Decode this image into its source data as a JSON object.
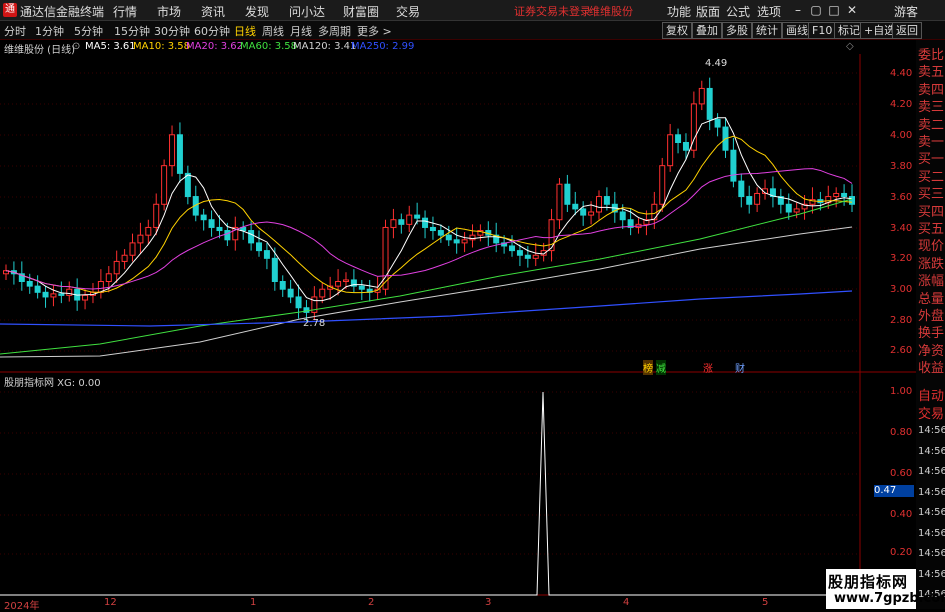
{
  "app": {
    "title": "通达信金融终端",
    "logo": "logo-icon"
  },
  "menu": [
    "行情",
    "市场",
    "资讯",
    "发现",
    "问小达",
    "财富圈",
    "交易"
  ],
  "notice": [
    "证券交易未登录",
    "维维股份"
  ],
  "menu_right": [
    "功能",
    "版面",
    "公式",
    "选项"
  ],
  "guest_label": "游客",
  "periods": [
    "分时",
    "1分钟",
    "5分钟",
    "15分钟",
    "30分钟",
    "60分钟",
    "日线",
    "周线",
    "月线",
    "多周期",
    "更多 >"
  ],
  "active_period": "日线",
  "tool_buttons": [
    "复权",
    "叠加",
    "多股",
    "统计",
    "画线",
    "F10",
    "标记",
    "+自选",
    "返回"
  ],
  "stock_label": "维维股份 (日线)",
  "ma_values": [
    {
      "label": "MA5: 3.61",
      "color": "#ffffff"
    },
    {
      "label": "MA10: 3.58",
      "color": "#ffd200"
    },
    {
      "label": "MA20: 3.62",
      "color": "#e040e0"
    },
    {
      "label": "MA60: 3.58",
      "color": "#40e040"
    },
    {
      "label": "MA120: 3.41",
      "color": "#d0d0d0"
    },
    {
      "label": "MA250: 2.99",
      "color": "#3050ff"
    }
  ],
  "price_axis": [
    "4.40",
    "4.20",
    "4.00",
    "3.80",
    "3.60",
    "3.40",
    "3.20",
    "3.00",
    "2.80",
    "2.60"
  ],
  "high_marker": "4.49",
  "low_marker": "2.78",
  "event_marks": [
    "榜",
    "减",
    "涨",
    "财"
  ],
  "indicator_label": "股朋指标网 XG: 0.00",
  "indicator_axis": [
    "1.00",
    "0.80",
    "0.60",
    "0.40",
    "0.20"
  ],
  "indicator_current": "0.47",
  "side_labels": [
    "委比",
    "卖五",
    "卖四",
    "卖三",
    "卖二",
    "卖一",
    "买一",
    "买二",
    "买三",
    "买四",
    "买五",
    "现价",
    "涨跌",
    "涨幅",
    "总量",
    "外盘",
    "换手",
    "净资",
    "收益"
  ],
  "side_bottom": [
    "自动",
    "交易"
  ],
  "side_times": [
    "14:56",
    "14:56",
    "14:56",
    "14:56",
    "14:56",
    "14:56",
    "14:56",
    "14:56",
    "14:56"
  ],
  "x_axis": [
    "2024年",
    "12",
    "1",
    "2",
    "3",
    "4",
    "5"
  ],
  "watermark": {
    "line1": "股朋指标网",
    "line2": "www.7gpzb.com"
  },
  "colors": {
    "up": "#ff3030",
    "down": "#20d0d0",
    "ma5": "#ffffff",
    "ma10": "#ffd200",
    "ma20": "#e040e0",
    "ma60": "#40e040",
    "ma120": "#d0d0d0",
    "ma250": "#3050ff",
    "grid": "#8b0000"
  }
}
